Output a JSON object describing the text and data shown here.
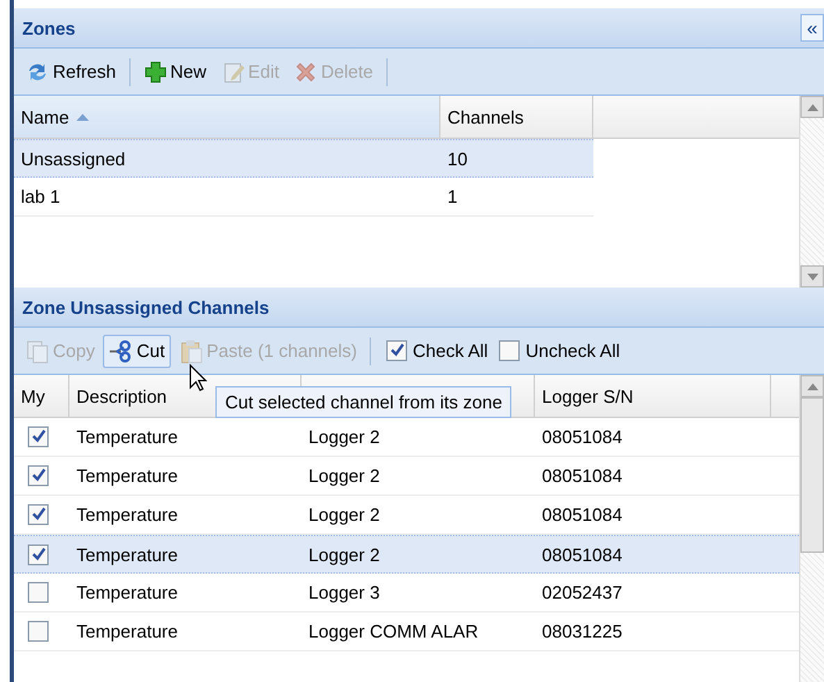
{
  "collapse_button": "«",
  "zones": {
    "title": "Zones",
    "toolbar": [
      {
        "label": "Refresh",
        "disabled": false
      },
      {
        "label": "New",
        "disabled": false
      },
      {
        "label": "Edit",
        "disabled": true
      },
      {
        "label": "Delete",
        "disabled": true
      }
    ],
    "columns": [
      {
        "label": "Name",
        "sorted": true
      },
      {
        "label": "Channels",
        "sorted": false
      }
    ],
    "rows": [
      {
        "cells": [
          "Unsassigned",
          "10"
        ],
        "selected": true
      },
      {
        "cells": [
          "lab 1",
          "1"
        ],
        "selected": false
      }
    ]
  },
  "channels": {
    "title": "Zone Unsassigned Channels",
    "toolbar": [
      {
        "kind": "button",
        "label": "Copy",
        "disabled": true,
        "hovered": false
      },
      {
        "kind": "button",
        "label": "Cut",
        "disabled": false,
        "hovered": true
      },
      {
        "kind": "button",
        "label": "Paste (1 channels)",
        "disabled": true,
        "hovered": false
      },
      {
        "kind": "checkbox",
        "label": "Check All",
        "checked": true
      },
      {
        "kind": "checkbox",
        "label": "Uncheck All",
        "checked": false
      }
    ],
    "columns": [
      "My",
      "Description",
      "",
      "Logger S/N"
    ],
    "rows": [
      {
        "checked": true,
        "cells": [
          "",
          "Temperature",
          "Logger 2",
          "08051084"
        ],
        "selected": false
      },
      {
        "checked": true,
        "cells": [
          "",
          "Temperature",
          "Logger 2",
          "08051084"
        ],
        "selected": false
      },
      {
        "checked": true,
        "cells": [
          "",
          "Temperature",
          "Logger 2",
          "08051084"
        ],
        "selected": false
      },
      {
        "checked": true,
        "cells": [
          "",
          "Temperature",
          "Logger 2",
          "08051084"
        ],
        "selected": true
      },
      {
        "checked": false,
        "cells": [
          "",
          "Temperature",
          "Logger 3",
          "02052437"
        ],
        "selected": false
      },
      {
        "checked": false,
        "cells": [
          "",
          "Temperature",
          "Logger COMM ALAR",
          "08031225"
        ],
        "selected": false
      }
    ],
    "tooltip": "Cut selected channel from its zone"
  }
}
